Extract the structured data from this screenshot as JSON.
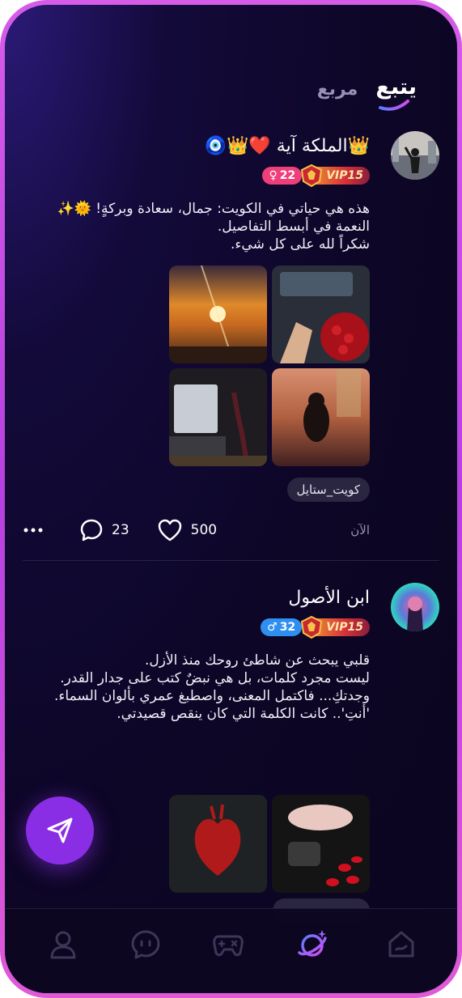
{
  "tabs": {
    "follow": "يتبع",
    "square": "مربع"
  },
  "posts": [
    {
      "username": "👑الملكة آية ❤️👑🧿",
      "vip_label": "VIP15",
      "age": "22",
      "gender_symbol": "♀",
      "text": "هذه هي حياتي في الكويت: جمال، سعادة وبركةٍ! 🌞✨ النعمة في أبسط التفاصيل.\nشكراً لله على كل شيء.",
      "tag": "كويت_ستايل",
      "time": "الآن",
      "likes": "500",
      "comments": "23"
    },
    {
      "username": "ابن الأصول",
      "vip_label": "VIP15",
      "age": "32",
      "gender_symbol": "♂",
      "text": "قلبي يبحث عن شاطئ روحك منذ الأزل.\nليست مجرد كلمات، بل هي نبضٌ كتب على جدار القدر.\nوجدتكِ... فاكتمل المعنى، واصطبغ عمري بألوان السماء.\n'أنتِ'.. كانت الكلمة التي كان ينقص قصيدتي."
    }
  ],
  "colors": {
    "accent": "#8a2ee6",
    "pink_badge": "#ee3f7a",
    "blue_badge": "#2f8ff0",
    "border": "#c94ee6"
  },
  "icons": [
    "send-icon",
    "profile-icon",
    "chat-icon",
    "game-icon",
    "planet-icon",
    "home-icon",
    "more-icon",
    "comment-icon",
    "heart-icon"
  ]
}
